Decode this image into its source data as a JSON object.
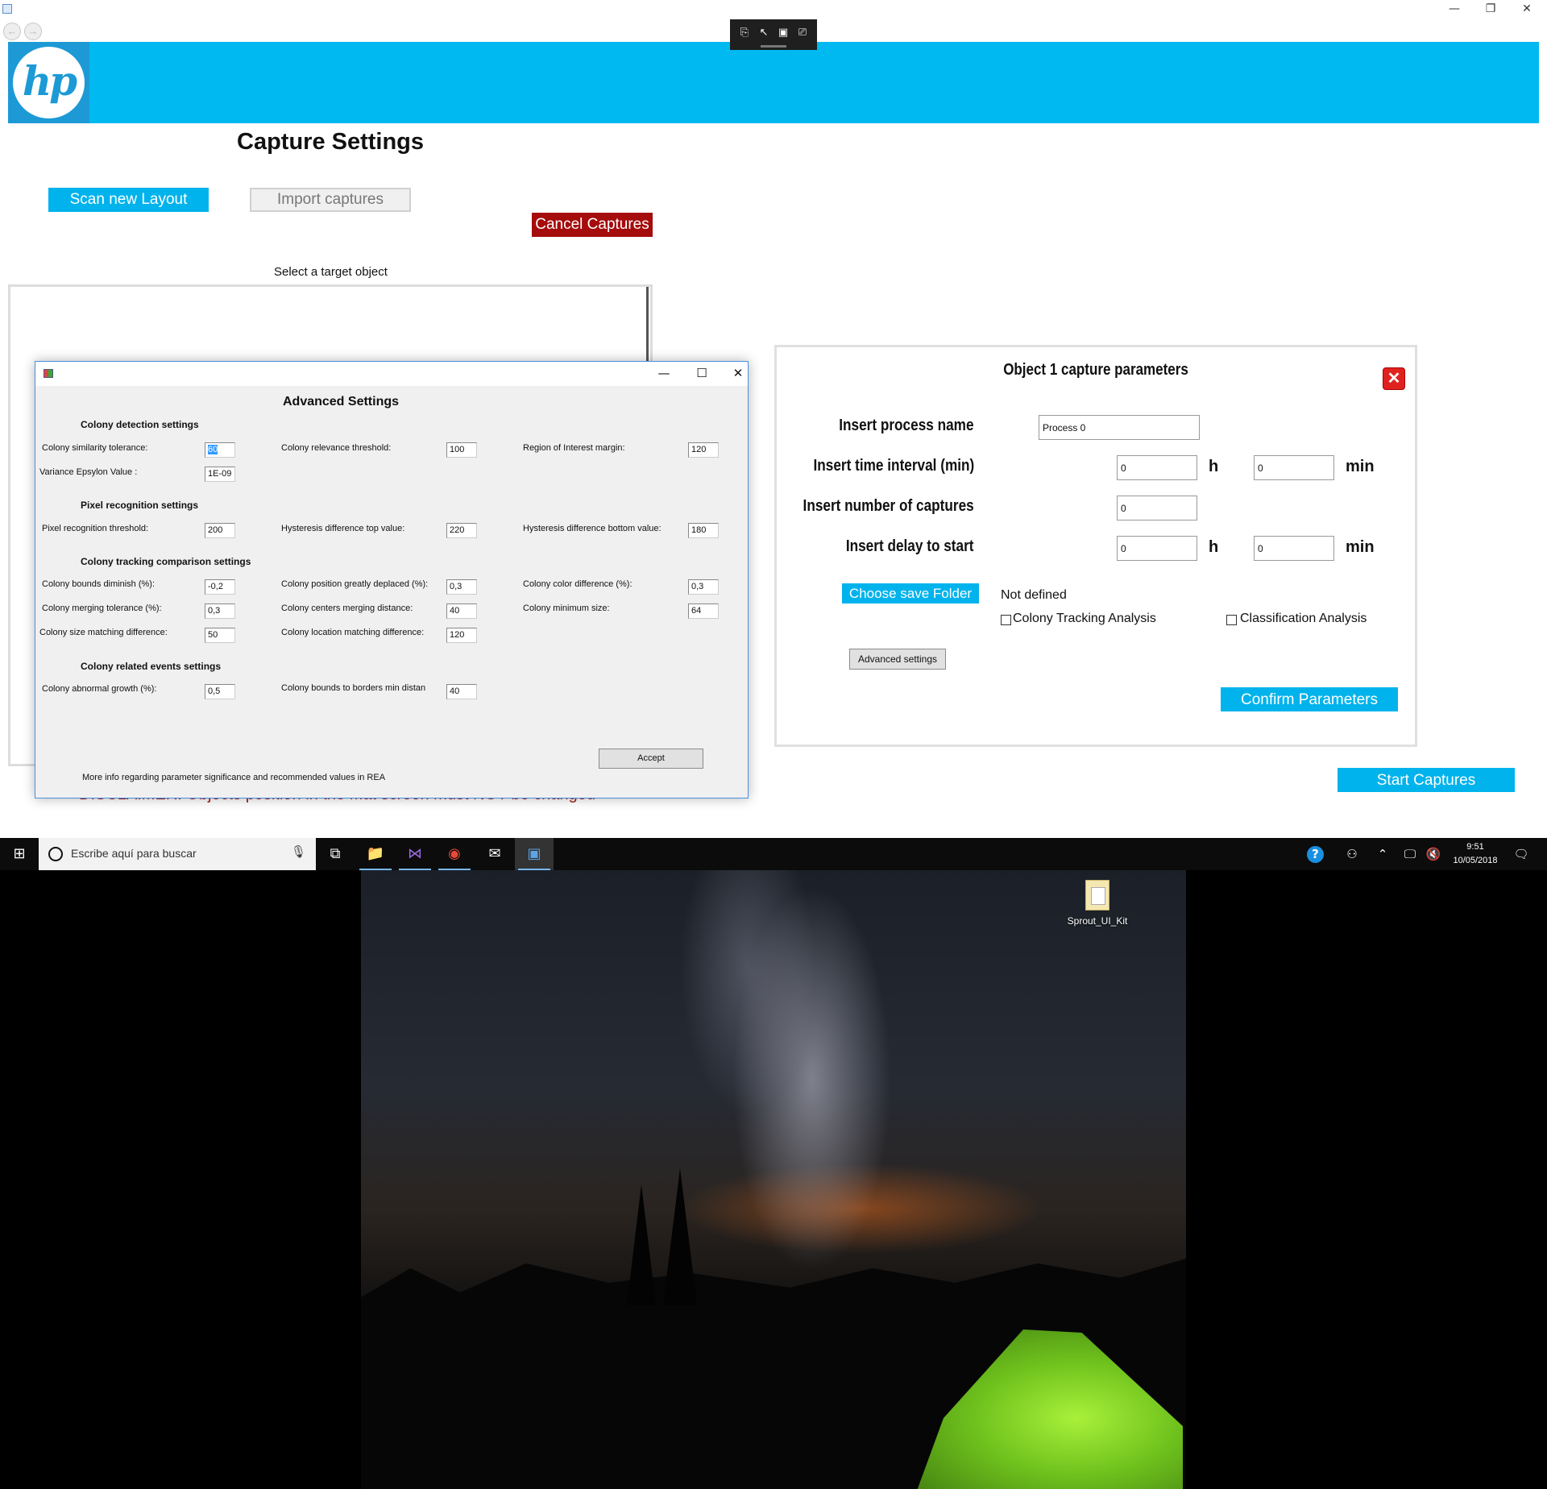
{
  "window": {
    "controls": {
      "minimize": "—",
      "restore": "❐",
      "close": "✕"
    },
    "nav": {
      "back": "←",
      "forward": "→"
    }
  },
  "overlay_toolbar": {
    "icons": [
      "select-tool-icon",
      "pointer-icon",
      "frame-icon",
      "screen-icon"
    ],
    "glyphs": [
      "⎘",
      "↖",
      "▣",
      "⎚"
    ]
  },
  "banner": {
    "logo_text": "hp",
    "color": "#00b9f1"
  },
  "page": {
    "title": "Capture Settings",
    "scan_button": "Scan new Layout",
    "import_button": "Import captures",
    "cancel_button": "Cancel Captures",
    "select_label": "Select a target object",
    "disclaimer": "DISCLAIMER: Objects position in the Mat screen must NOT be changed",
    "start_button": "Start Captures"
  },
  "params_panel": {
    "title": "Object 1 capture parameters",
    "close_glyph": "✕",
    "process_name_label": "Insert process name",
    "process_name_value": "Process 0",
    "interval_label": "Insert time interval (min)",
    "interval_h": "0",
    "interval_min": "0",
    "captures_label": "Insert number of captures",
    "captures_value": "0",
    "delay_label": "Insert delay to start",
    "delay_h": "0",
    "delay_min": "0",
    "unit_h": "h",
    "unit_min": "min",
    "folder_button": "Choose save Folder",
    "folder_status": "Not defined",
    "tracking_label": "Colony Tracking Analysis",
    "tracking_checked": false,
    "classification_label": "Classification Analysis",
    "classification_checked": false,
    "advanced_button": "Advanced settings",
    "confirm_button": "Confirm Parameters"
  },
  "advanced": {
    "title": "Advanced Settings",
    "controls": {
      "minimize": "—",
      "maximize": "☐",
      "close": "✕"
    },
    "sections": {
      "detection": "Colony detection settings",
      "pixel": "Pixel recognition settings",
      "tracking": "Colony tracking comparison settings",
      "events": "Colony related events settings"
    },
    "fields": {
      "similarity": {
        "label": "Colony similarity tolerance:",
        "value": "60"
      },
      "relevance": {
        "label": "Colony relevance threshold:",
        "value": "100"
      },
      "roi_margin": {
        "label": "Region of Interest margin:",
        "value": "120"
      },
      "variance": {
        "label": "Variance Epsylon Value :",
        "value": "1E-09"
      },
      "pixel_threshold": {
        "label": "Pixel recognition threshold:",
        "value": "200"
      },
      "hyst_top": {
        "label": "Hysteresis difference top value:",
        "value": "220"
      },
      "hyst_bottom": {
        "label": "Hysteresis difference bottom value:",
        "value": "180"
      },
      "bounds_diminish": {
        "label": "Colony bounds diminish (%):",
        "value": "-0,2"
      },
      "position_deplaced": {
        "label": "Colony position greatly deplaced (%):",
        "value": "0,3"
      },
      "color_diff": {
        "label": "Colony color difference (%):",
        "value": "0,3"
      },
      "merging_tol": {
        "label": "Colony merging tolerance (%):",
        "value": "0,3"
      },
      "centers_merging": {
        "label": "Colony centers merging distance:",
        "value": "40"
      },
      "min_size": {
        "label": "Colony minimum size:",
        "value": "64"
      },
      "size_matching": {
        "label": "Colony size matching difference:",
        "value": "50"
      },
      "location_matching": {
        "label": "Colony location matching difference:",
        "value": "120"
      },
      "abnormal_growth": {
        "label": "Colony abnormal growth (%):",
        "value": "0,5"
      },
      "bounds_borders": {
        "label": "Colony bounds to borders min distan",
        "value": "40"
      }
    },
    "accept_button": "Accept",
    "info_text": "More info regarding parameter significance and recommended values in REA"
  },
  "taskbar": {
    "search_placeholder": "Escribe aquí para buscar",
    "start_glyph": "⊞",
    "mic_glyph": "🎙",
    "apps": [
      {
        "name": "task-view-icon",
        "glyph": "⧉"
      },
      {
        "name": "file-explorer-icon",
        "glyph": "📁"
      },
      {
        "name": "visual-studio-icon",
        "glyph": "⋈"
      },
      {
        "name": "chrome-icon",
        "glyph": "◉"
      },
      {
        "name": "mail-icon",
        "glyph": "✉"
      },
      {
        "name": "app-window-icon",
        "glyph": "▣"
      }
    ],
    "tray": {
      "help": "?",
      "people": "⚇",
      "chevron": "⌃",
      "network": "🖵",
      "volume": "🔇",
      "notifications": "🗨"
    },
    "time": "9:51",
    "date": "10/05/2018"
  },
  "desktop": {
    "icon_label": "Sprout_UI_Kit"
  }
}
